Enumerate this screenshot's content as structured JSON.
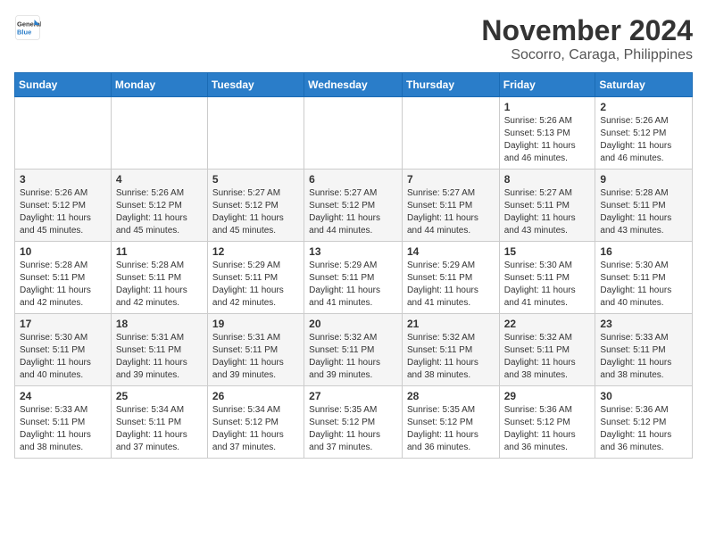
{
  "header": {
    "logo": {
      "line1": "General",
      "line2": "Blue"
    },
    "title": "November 2024",
    "location": "Socorro, Caraga, Philippines"
  },
  "calendar": {
    "weekdays": [
      "Sunday",
      "Monday",
      "Tuesday",
      "Wednesday",
      "Thursday",
      "Friday",
      "Saturday"
    ],
    "weeks": [
      [
        {
          "day": null,
          "info": null
        },
        {
          "day": null,
          "info": null
        },
        {
          "day": null,
          "info": null
        },
        {
          "day": null,
          "info": null
        },
        {
          "day": null,
          "info": null
        },
        {
          "day": "1",
          "info": "Sunrise: 5:26 AM\nSunset: 5:13 PM\nDaylight: 11 hours\nand 46 minutes."
        },
        {
          "day": "2",
          "info": "Sunrise: 5:26 AM\nSunset: 5:12 PM\nDaylight: 11 hours\nand 46 minutes."
        }
      ],
      [
        {
          "day": "3",
          "info": "Sunrise: 5:26 AM\nSunset: 5:12 PM\nDaylight: 11 hours\nand 45 minutes."
        },
        {
          "day": "4",
          "info": "Sunrise: 5:26 AM\nSunset: 5:12 PM\nDaylight: 11 hours\nand 45 minutes."
        },
        {
          "day": "5",
          "info": "Sunrise: 5:27 AM\nSunset: 5:12 PM\nDaylight: 11 hours\nand 45 minutes."
        },
        {
          "day": "6",
          "info": "Sunrise: 5:27 AM\nSunset: 5:12 PM\nDaylight: 11 hours\nand 44 minutes."
        },
        {
          "day": "7",
          "info": "Sunrise: 5:27 AM\nSunset: 5:11 PM\nDaylight: 11 hours\nand 44 minutes."
        },
        {
          "day": "8",
          "info": "Sunrise: 5:27 AM\nSunset: 5:11 PM\nDaylight: 11 hours\nand 43 minutes."
        },
        {
          "day": "9",
          "info": "Sunrise: 5:28 AM\nSunset: 5:11 PM\nDaylight: 11 hours\nand 43 minutes."
        }
      ],
      [
        {
          "day": "10",
          "info": "Sunrise: 5:28 AM\nSunset: 5:11 PM\nDaylight: 11 hours\nand 42 minutes."
        },
        {
          "day": "11",
          "info": "Sunrise: 5:28 AM\nSunset: 5:11 PM\nDaylight: 11 hours\nand 42 minutes."
        },
        {
          "day": "12",
          "info": "Sunrise: 5:29 AM\nSunset: 5:11 PM\nDaylight: 11 hours\nand 42 minutes."
        },
        {
          "day": "13",
          "info": "Sunrise: 5:29 AM\nSunset: 5:11 PM\nDaylight: 11 hours\nand 41 minutes."
        },
        {
          "day": "14",
          "info": "Sunrise: 5:29 AM\nSunset: 5:11 PM\nDaylight: 11 hours\nand 41 minutes."
        },
        {
          "day": "15",
          "info": "Sunrise: 5:30 AM\nSunset: 5:11 PM\nDaylight: 11 hours\nand 41 minutes."
        },
        {
          "day": "16",
          "info": "Sunrise: 5:30 AM\nSunset: 5:11 PM\nDaylight: 11 hours\nand 40 minutes."
        }
      ],
      [
        {
          "day": "17",
          "info": "Sunrise: 5:30 AM\nSunset: 5:11 PM\nDaylight: 11 hours\nand 40 minutes."
        },
        {
          "day": "18",
          "info": "Sunrise: 5:31 AM\nSunset: 5:11 PM\nDaylight: 11 hours\nand 39 minutes."
        },
        {
          "day": "19",
          "info": "Sunrise: 5:31 AM\nSunset: 5:11 PM\nDaylight: 11 hours\nand 39 minutes."
        },
        {
          "day": "20",
          "info": "Sunrise: 5:32 AM\nSunset: 5:11 PM\nDaylight: 11 hours\nand 39 minutes."
        },
        {
          "day": "21",
          "info": "Sunrise: 5:32 AM\nSunset: 5:11 PM\nDaylight: 11 hours\nand 38 minutes."
        },
        {
          "day": "22",
          "info": "Sunrise: 5:32 AM\nSunset: 5:11 PM\nDaylight: 11 hours\nand 38 minutes."
        },
        {
          "day": "23",
          "info": "Sunrise: 5:33 AM\nSunset: 5:11 PM\nDaylight: 11 hours\nand 38 minutes."
        }
      ],
      [
        {
          "day": "24",
          "info": "Sunrise: 5:33 AM\nSunset: 5:11 PM\nDaylight: 11 hours\nand 38 minutes."
        },
        {
          "day": "25",
          "info": "Sunrise: 5:34 AM\nSunset: 5:11 PM\nDaylight: 11 hours\nand 37 minutes."
        },
        {
          "day": "26",
          "info": "Sunrise: 5:34 AM\nSunset: 5:12 PM\nDaylight: 11 hours\nand 37 minutes."
        },
        {
          "day": "27",
          "info": "Sunrise: 5:35 AM\nSunset: 5:12 PM\nDaylight: 11 hours\nand 37 minutes."
        },
        {
          "day": "28",
          "info": "Sunrise: 5:35 AM\nSunset: 5:12 PM\nDaylight: 11 hours\nand 36 minutes."
        },
        {
          "day": "29",
          "info": "Sunrise: 5:36 AM\nSunset: 5:12 PM\nDaylight: 11 hours\nand 36 minutes."
        },
        {
          "day": "30",
          "info": "Sunrise: 5:36 AM\nSunset: 5:12 PM\nDaylight: 11 hours\nand 36 minutes."
        }
      ]
    ]
  }
}
